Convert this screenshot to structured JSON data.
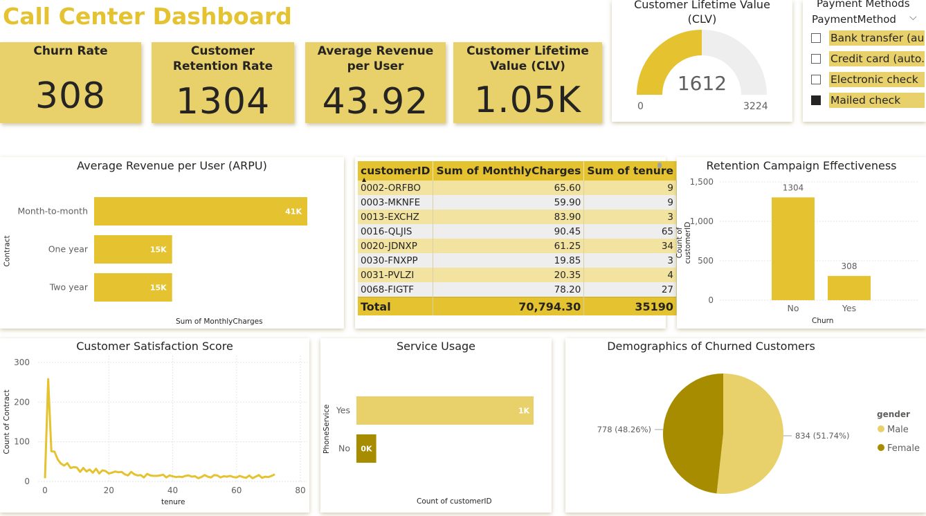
{
  "dashboard": {
    "title": "Call Center Dashboard"
  },
  "colors": {
    "accent": "#e4c230",
    "card": "#e8d16a",
    "dark": "#a78c00",
    "light": "#e8d16a"
  },
  "kpis": [
    {
      "title": "Churn Rate",
      "value": "308"
    },
    {
      "title": "Customer Retention Rate",
      "value": "1304"
    },
    {
      "title": "Average Revenue per User",
      "value": "43.92"
    },
    {
      "title": "Customer Lifetime Value (CLV)",
      "value": "1.05K"
    }
  ],
  "gauge": {
    "title": "Customer Lifetime Value (CLV)",
    "value_label": "1612",
    "min_label": "0",
    "max_label": "3224",
    "value": 1612,
    "min": 0,
    "max": 3224
  },
  "slicer": {
    "title": "Payment Methods",
    "field": "PaymentMethod",
    "options": [
      {
        "label": "Bank transfer (au...",
        "checked": false
      },
      {
        "label": "Credit card (auto...",
        "checked": false
      },
      {
        "label": "Electronic check",
        "checked": false
      },
      {
        "label": "Mailed check",
        "checked": true
      }
    ]
  },
  "arpu": {
    "title": "Average Revenue per User (ARPU)",
    "xlabel": "Sum of MonthlyCharges",
    "ylabel": "Contract",
    "categories": [
      "Month-to-month",
      "One year",
      "Two year"
    ],
    "labels": [
      "41K",
      "15K",
      "15K"
    ]
  },
  "table": {
    "headers": [
      "customerID",
      "Sum of MonthlyCharges",
      "Sum of tenure"
    ],
    "rows": [
      [
        "0002-ORFBO",
        "65.60",
        "9"
      ],
      [
        "0003-MKNFE",
        "59.90",
        "9"
      ],
      [
        "0013-EXCHZ",
        "83.90",
        "3"
      ],
      [
        "0016-QLJIS",
        "90.45",
        "65"
      ],
      [
        "0020-JDNXP",
        "61.25",
        "34"
      ],
      [
        "0030-FNXPP",
        "19.85",
        "3"
      ],
      [
        "0031-PVLZI",
        "20.35",
        "4"
      ],
      [
        "0068-FIGTF",
        "78.20",
        "27"
      ]
    ],
    "total": [
      "Total",
      "70,794.30",
      "35190"
    ]
  },
  "retention": {
    "title": "Retention Campaign Effectiveness",
    "xlabel": "Churn",
    "ylabel": "Count of customerID",
    "yticks": [
      "0",
      "500",
      "1,000",
      "1,500"
    ]
  },
  "satisfaction": {
    "title": "Customer Satisfaction Score",
    "xlabel": "tenure",
    "ylabel": "Count of Contract",
    "xticks": [
      "0",
      "20",
      "40",
      "60",
      "80"
    ],
    "yticks": [
      "0",
      "100",
      "200",
      "300"
    ]
  },
  "service": {
    "title": "Service Usage",
    "xlabel": "Count of customerID",
    "ylabel": "PhoneService",
    "categories": [
      "Yes",
      "No"
    ],
    "labels": [
      "1K",
      "0K"
    ]
  },
  "demographics": {
    "title": "Demographics of Churned Customers",
    "legend_title": "gender",
    "slice_labels": [
      "834 (51.74%)",
      "778 (48.26%)"
    ]
  },
  "chart_data": [
    {
      "type": "bar",
      "title": "Average Revenue per User (ARPU)",
      "categories": [
        "Month-to-month",
        "One year",
        "Two year"
      ],
      "values": [
        41000,
        15000,
        15000
      ],
      "xlabel": "Sum of MonthlyCharges",
      "ylabel": "Contract"
    },
    {
      "type": "bar",
      "title": "Retention Campaign Effectiveness",
      "categories": [
        "No",
        "Yes"
      ],
      "values": [
        1304,
        308
      ],
      "xlabel": "Churn",
      "ylabel": "Count of customerID",
      "ylim": [
        0,
        1500
      ]
    },
    {
      "type": "line",
      "title": "Customer Satisfaction Score",
      "x": [
        0,
        1,
        2,
        3,
        4,
        5,
        6,
        7,
        8,
        9,
        10,
        11,
        12,
        13,
        14,
        15,
        16,
        17,
        18,
        19,
        20,
        21,
        22,
        23,
        24,
        25,
        26,
        27,
        28,
        29,
        30,
        31,
        32,
        33,
        34,
        35,
        36,
        37,
        38,
        39,
        40,
        41,
        42,
        43,
        44,
        45,
        46,
        47,
        48,
        49,
        50,
        51,
        52,
        53,
        54,
        55,
        56,
        57,
        58,
        59,
        60,
        61,
        62,
        63,
        64,
        65,
        66,
        67,
        68,
        69,
        70,
        71,
        72
      ],
      "values": [
        8,
        258,
        76,
        75,
        55,
        45,
        40,
        46,
        34,
        36,
        35,
        24,
        34,
        25,
        30,
        22,
        32,
        20,
        28,
        26,
        20,
        22,
        25,
        23,
        24,
        18,
        15,
        24,
        18,
        15,
        16,
        10,
        19,
        15,
        14,
        14,
        15,
        17,
        10,
        15,
        13,
        11,
        12,
        11,
        14,
        15,
        12,
        13,
        8,
        11,
        16,
        12,
        10,
        16,
        15,
        10,
        13,
        12,
        14,
        11,
        10,
        14,
        11,
        9,
        15,
        8,
        12,
        16,
        9,
        12,
        11,
        14,
        18
      ],
      "xlabel": "tenure",
      "ylabel": "Count of Contract",
      "xlim": [
        0,
        80
      ],
      "ylim": [
        0,
        300
      ],
      "grid": true
    },
    {
      "type": "bar",
      "title": "Service Usage",
      "categories": [
        "Yes",
        "No"
      ],
      "values": [
        1450,
        162
      ],
      "xlabel": "Count of customerID",
      "ylabel": "PhoneService"
    },
    {
      "type": "pie",
      "title": "Demographics of Churned Customers",
      "series": [
        {
          "name": "Male",
          "value": 834,
          "color": "#e8d16a"
        },
        {
          "name": "Female",
          "value": 778,
          "color": "#a78c00"
        }
      ],
      "legend": "right"
    }
  ]
}
